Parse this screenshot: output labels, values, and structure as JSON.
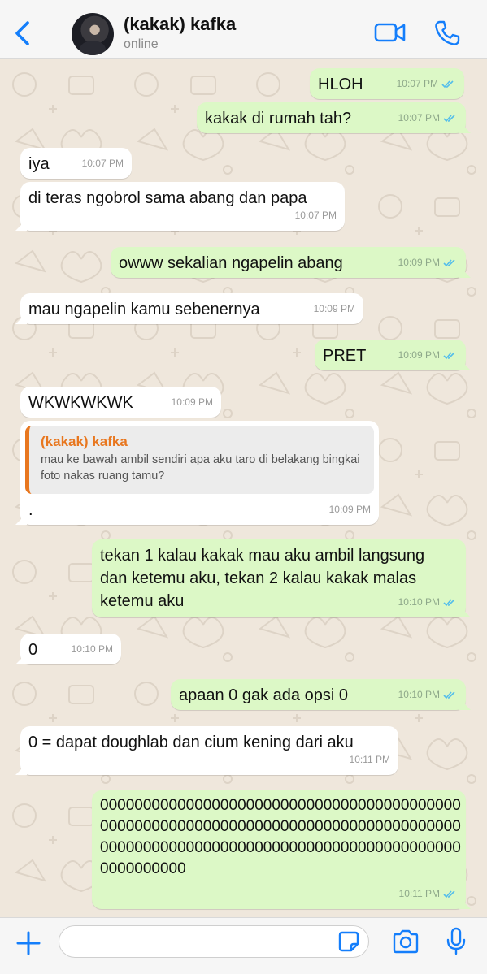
{
  "header": {
    "contact_name": "(kakak) kafka",
    "status": "online",
    "icons": [
      "back-chevron-icon",
      "video-call-icon",
      "phone-call-icon"
    ]
  },
  "colors": {
    "accent": "#147efb",
    "outgoing_bubble": "#dcf8c6",
    "incoming_bubble": "#ffffff",
    "chat_background": "#efe7dc",
    "quote_bar": "#e8771f",
    "read_ticks": "#53bdeb"
  },
  "messages": [
    {
      "dir": "out",
      "text": "HLOH",
      "time": "10:07 PM"
    },
    {
      "dir": "out",
      "text": "kakak di rumah tah?",
      "time": "10:07 PM"
    },
    {
      "dir": "in",
      "text": "iya",
      "time": "10:07 PM"
    },
    {
      "dir": "in",
      "text": "di teras ngobrol sama abang dan papa",
      "time": "10:07 PM"
    },
    {
      "dir": "out",
      "text": "owww sekalian ngapelin abang",
      "time": "10:09 PM"
    },
    {
      "dir": "in",
      "text": "mau ngapelin kamu sebenernya",
      "time": "10:09 PM"
    },
    {
      "dir": "out",
      "text": "PRET",
      "time": "10:09 PM"
    },
    {
      "dir": "in",
      "text": "WKWKWKWK",
      "time": "10:09 PM"
    },
    {
      "dir": "in",
      "quote_name": "(kakak) kafka",
      "quote_text": "mau ke bawah ambil sendiri apa aku taro di belakang bingkai foto nakas ruang tamu?",
      "text": ".",
      "time": "10:09 PM"
    },
    {
      "dir": "out",
      "text": "tekan 1 kalau kakak mau aku ambil langsung dan ketemu aku, tekan 2 kalau kakak malas ketemu aku",
      "time": "10:10 PM"
    },
    {
      "dir": "in",
      "text": "0",
      "time": "10:10 PM"
    },
    {
      "dir": "out",
      "text": "apaan 0 gak ada opsi 0",
      "time": "10:10 PM"
    },
    {
      "dir": "in",
      "text": "0 = dapat doughlab dan cium kening dari aku",
      "time": "10:11 PM"
    },
    {
      "dir": "out",
      "text": "0000000000000000000000000000000000000000000000000000000000000000000000000000000000000000000000000000000000000000000000000000000000000000",
      "time": "10:11 PM"
    }
  ],
  "footer": {
    "input_value": "",
    "icons": [
      "plus-icon",
      "sticker-icon",
      "camera-icon",
      "microphone-icon"
    ]
  }
}
